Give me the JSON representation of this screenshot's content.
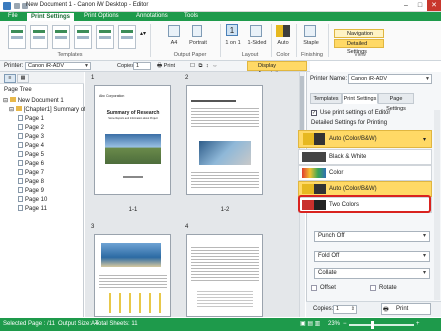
{
  "window": {
    "title": "New Document 1 - Canon iW Desktop - Editor"
  },
  "ribbon": {
    "tabs": [
      "File",
      "Print Settings",
      "Print Options",
      "Annotations",
      "Tools"
    ],
    "active_tab": "Print Settings",
    "groups": {
      "templates": "Templates",
      "output_paper": "Output Paper",
      "layout": "Layout",
      "color": "Color",
      "finishing": "Finishing",
      "view": "View"
    },
    "buttons": {
      "paper_size": "A4",
      "orientation": "Portrait",
      "pages_per_sheet": "1 on 1",
      "sided": "1-Sided",
      "color_mode": "Auto",
      "staple": "Staple",
      "navigation": "Navigation",
      "detailed_settings": "Detailed Settings"
    }
  },
  "printer_bar": {
    "printer_label": "Printer:",
    "printer_value": "Canon iR-ADV",
    "copies_label": "Copies:",
    "copies_value": "1",
    "print_label": "Print",
    "display_annotations": "Display Annotations"
  },
  "left_panel": {
    "title": "Page Tree",
    "document": "New Document 1",
    "chapter": "[Chapter1] Summary of R",
    "pages": [
      "Page 1",
      "Page 2",
      "Page 3",
      "Page 4",
      "Page 5",
      "Page 6",
      "Page 7",
      "Page 8",
      "Page 9",
      "Page 10",
      "Page 11"
    ]
  },
  "center": {
    "thumb_numbers": [
      "1",
      "2",
      "3",
      "4"
    ],
    "captions": [
      "1-1",
      "1-2",
      "",
      ""
    ],
    "page1_title": "Summary of Research",
    "page1_sub": "Some Reports and Information about Project",
    "page1_company": "Abc Corporation"
  },
  "right_panel": {
    "printer_name_label": "Printer Name:",
    "printer_name_value": "Canon iR-ADV",
    "tabs": [
      "Templates",
      "Print Settings",
      "Page Settings"
    ],
    "active_tab": "Print Settings",
    "use_editor_settings": "Use print settings of Editor",
    "detailed_label": "Detailed Settings for Printing",
    "color_dropdown": "Auto (Color/B&W)",
    "color_options": [
      "Black & White",
      "Color",
      "Auto (Color/B&W)",
      "Two Colors"
    ],
    "punch": "Punch Off",
    "fold": "Fold Off",
    "collate": "Collate",
    "offset": "Offset",
    "rotate": "Rotate",
    "copies_label": "Copies:",
    "copies_value": "1",
    "print_button": "Print"
  },
  "status_bar": {
    "selected_page": "Selected Page : /11",
    "output_size": "Output Size:A4",
    "total_sheets": "Total Sheets: 11",
    "zoom": "23%"
  },
  "colors": {
    "accent": "#1e9a4b",
    "highlight": "#ffd966",
    "callout": "#d9231f"
  }
}
